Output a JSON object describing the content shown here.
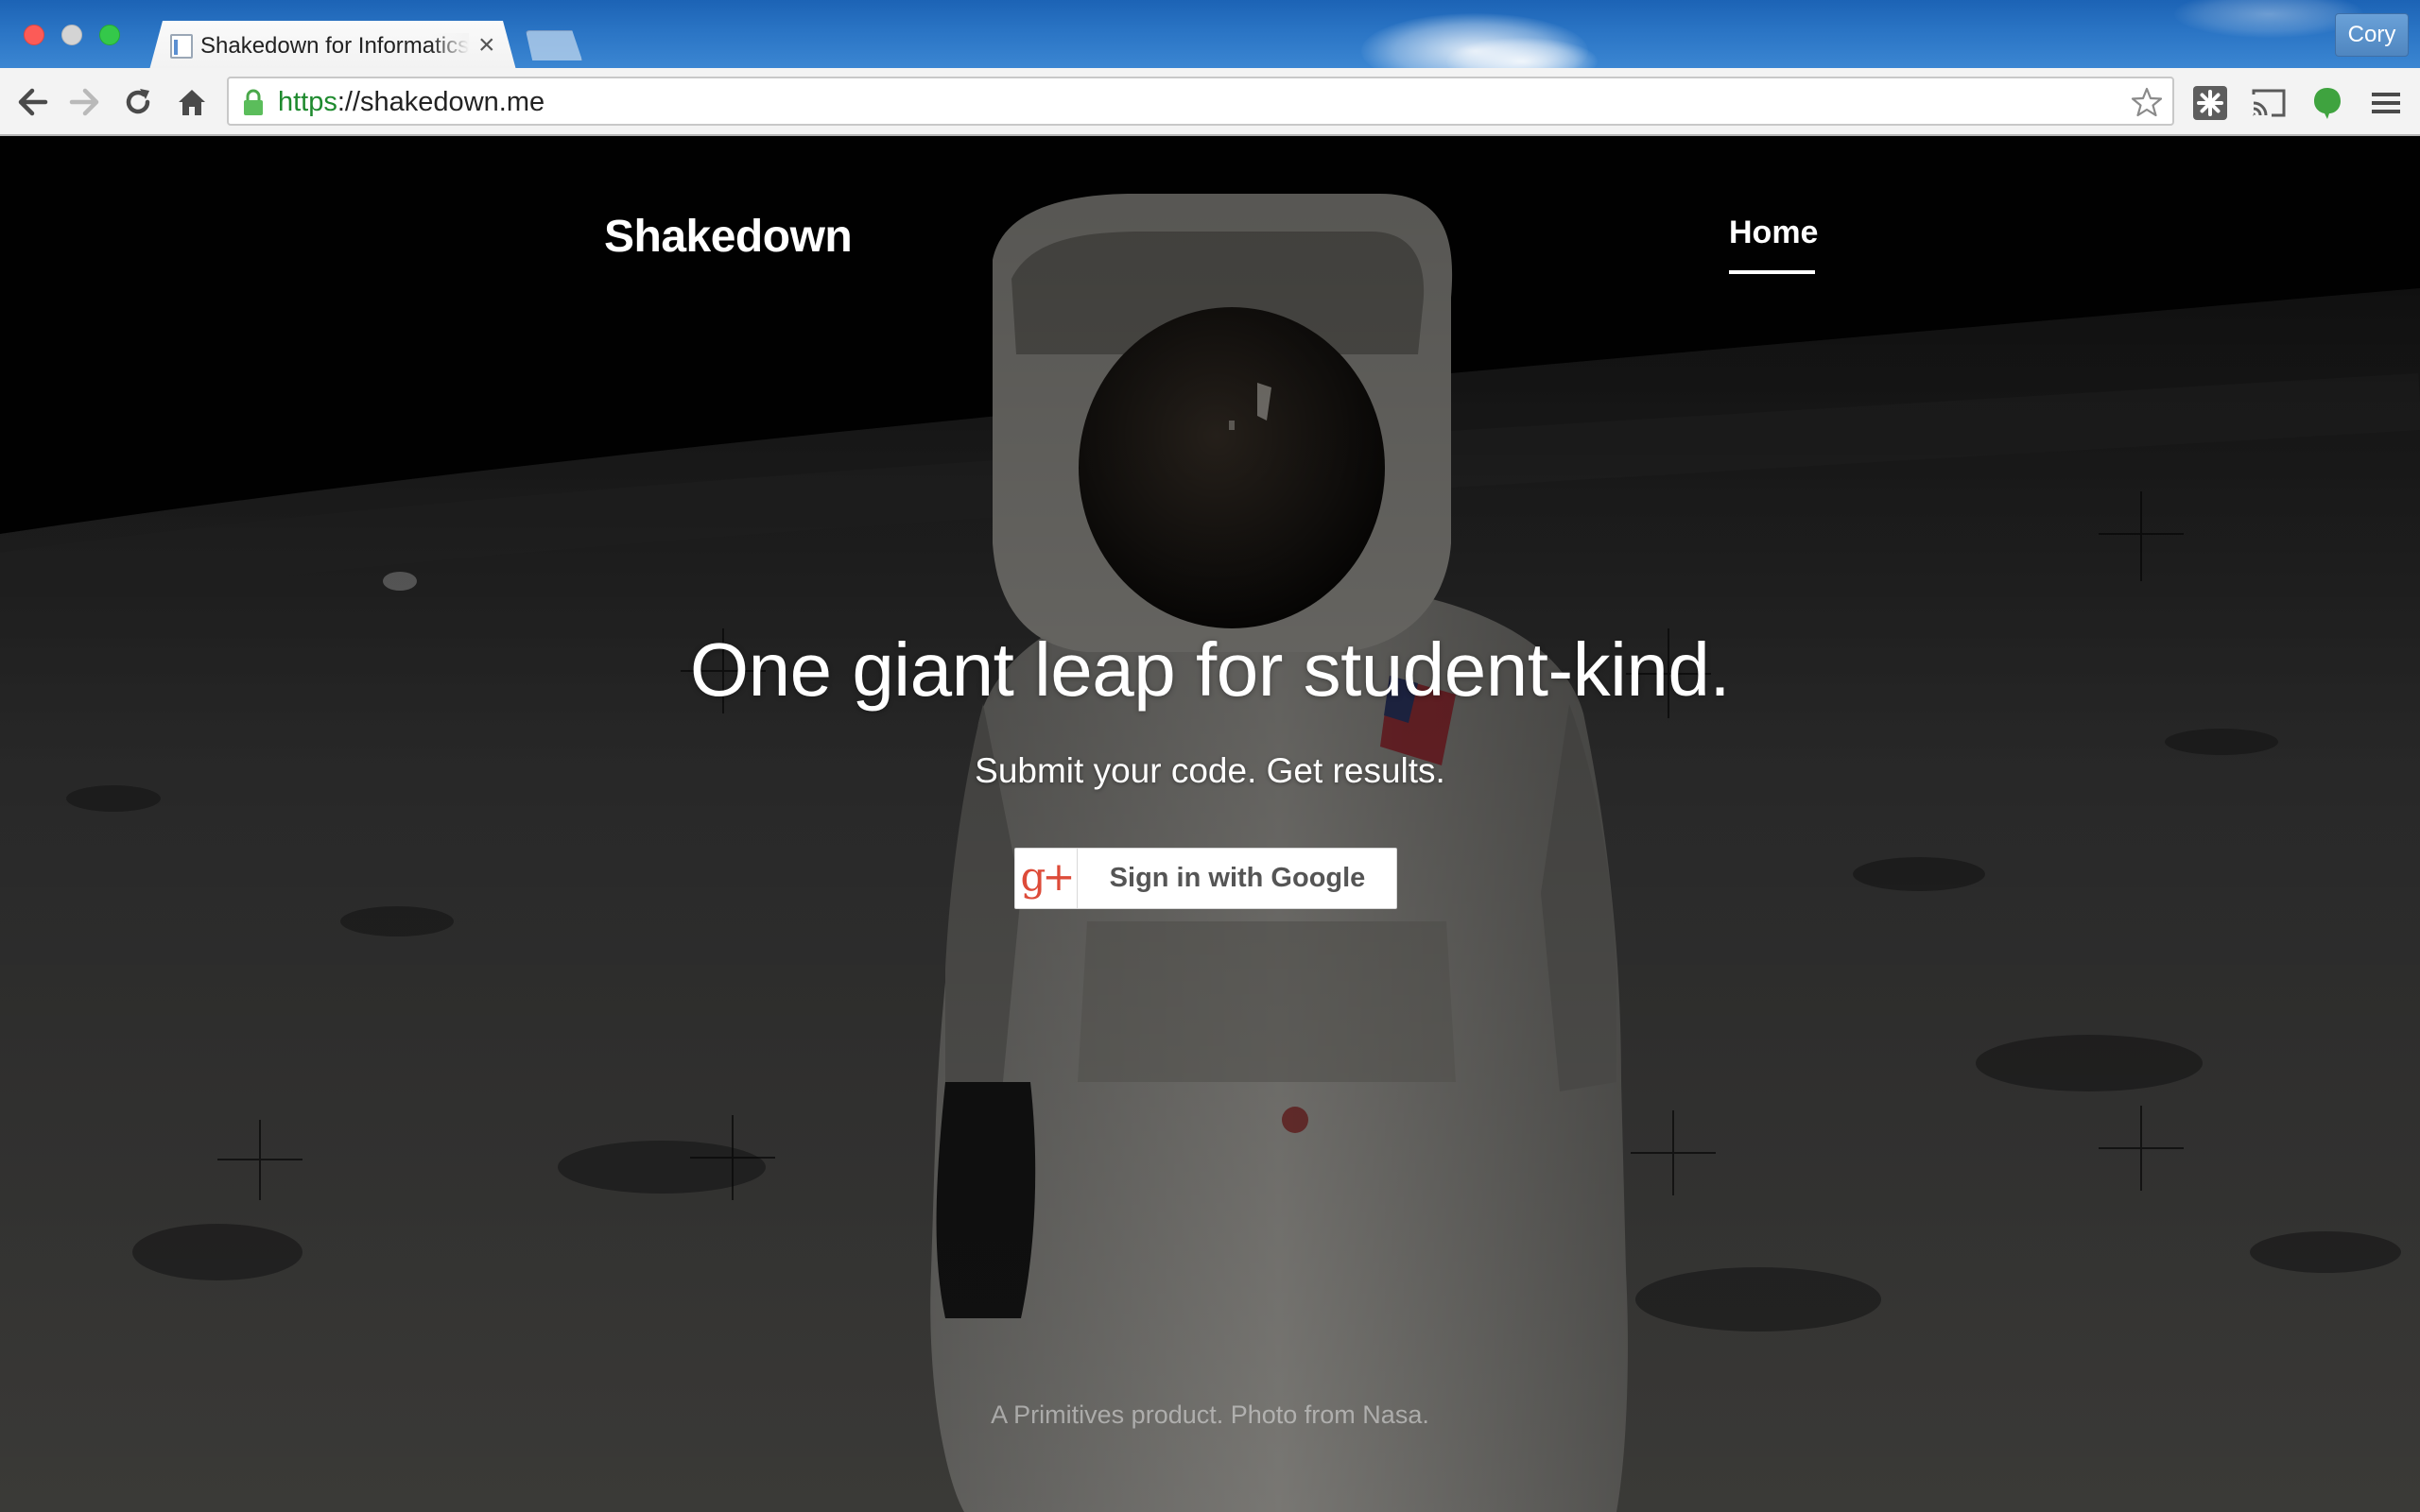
{
  "window": {
    "tab": {
      "title": "Shakedown for Informatics",
      "close_glyph": "×"
    },
    "profile_name": "Cory"
  },
  "toolbar": {
    "url_scheme": "https",
    "url_rest": "://shakedown.me",
    "icons": [
      "back-icon",
      "forward-icon",
      "reload-icon",
      "home-icon",
      "lock-icon",
      "bookmark-star-icon",
      "puzzle-extension-icon",
      "cast-icon",
      "evernote-icon",
      "menu-icon"
    ]
  },
  "site": {
    "brand": "Shakedown",
    "nav": {
      "home_label": "Home"
    },
    "hero": {
      "title": "One giant leap for student-kind.",
      "subtitle": "Submit your code. Get results."
    },
    "signin": {
      "icon_text": "g+",
      "label": "Sign in with Google"
    },
    "footer": "A Primitives product. Photo from Nasa."
  },
  "colors": {
    "url_secure": "#1e8a2e",
    "google_red": "#dd4b39",
    "titlebar_blue": "#2a74c4"
  }
}
